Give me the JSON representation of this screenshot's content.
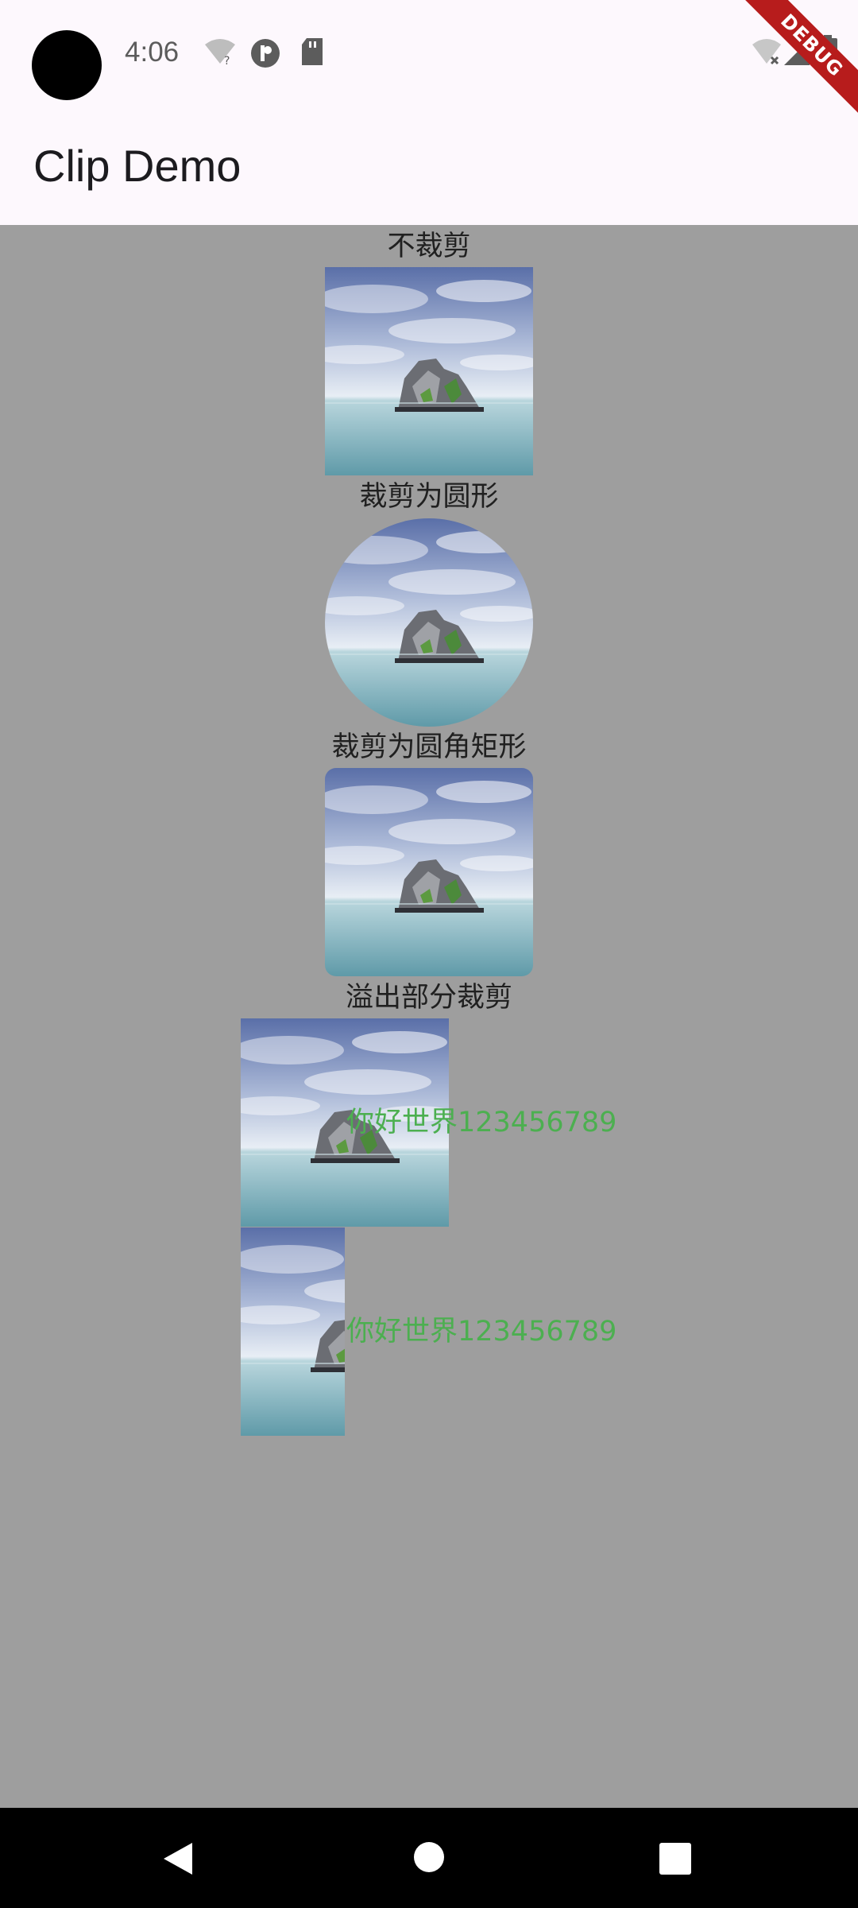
{
  "status_bar": {
    "time": "4:06",
    "icons": [
      "wifi-question-icon",
      "pinterest-icon",
      "sd-card-icon",
      "wifi-off-icon",
      "signal-icon",
      "battery-icon"
    ]
  },
  "app_bar": {
    "title": "Clip Demo"
  },
  "debug_banner": {
    "label": "DEBUG"
  },
  "sections": {
    "no_clip": {
      "label": "不裁剪"
    },
    "clip_oval": {
      "label": "裁剪为圆形"
    },
    "clip_rrect": {
      "label": "裁剪为圆角矩形"
    },
    "overflow_clip": {
      "label": "溢出部分裁剪"
    }
  },
  "overflow_rows": [
    {
      "text": "你好世界123456789"
    },
    {
      "text": "你好世界123456789"
    }
  ],
  "nav_bar": {
    "icons": [
      "back-icon",
      "home-icon",
      "recents-icon"
    ]
  },
  "colors": {
    "background": "#9e9e9e",
    "app_bar": "#fdf8fd",
    "green_text": "#4caf50",
    "debug": "#b71c1c"
  }
}
